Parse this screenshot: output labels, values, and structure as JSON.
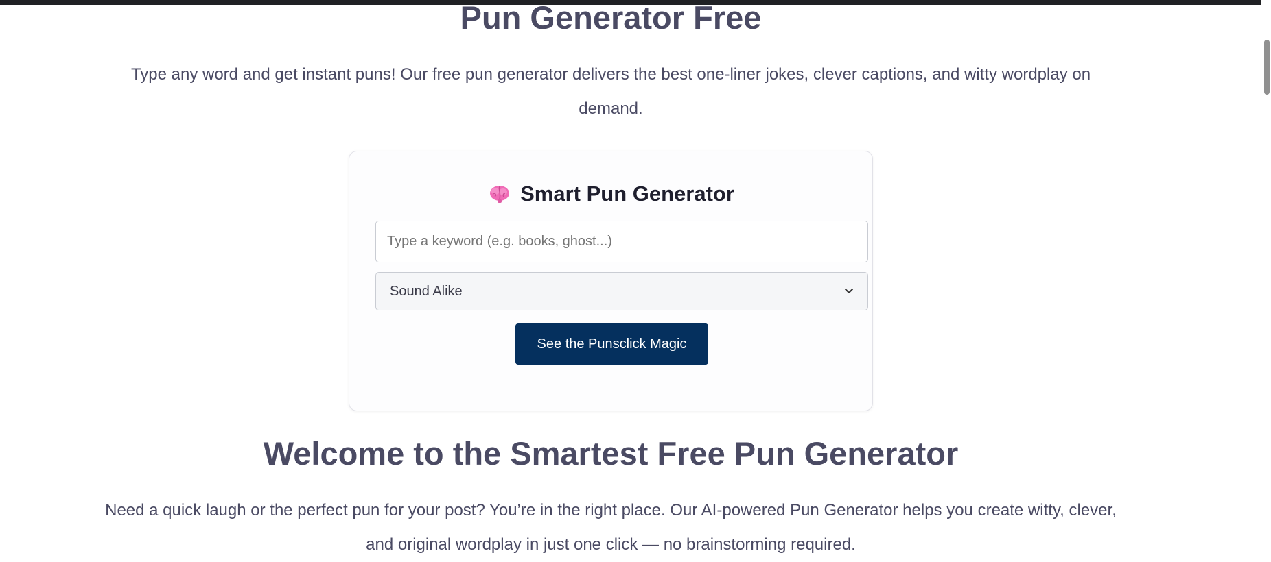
{
  "page": {
    "title": "Pun Generator Free",
    "intro": "Type any word and get instant puns! Our free pun generator delivers the best one-liner jokes, clever captions, and witty wordplay on demand."
  },
  "generator": {
    "title": "Smart Pun Generator",
    "title_icon": "brain-icon",
    "keyword_placeholder": "Type a keyword (e.g. books, ghost...)",
    "keyword_value": "",
    "pun_type_selected": "Sound Alike",
    "submit_label": "See the Punsclick Magic"
  },
  "welcome": {
    "title": "Welcome to the Smartest Free Pun Generator",
    "text": "Need a quick laugh or the perfect pun for your post? You’re in the right place. Our AI-powered Pun Generator helps you create witty, clever, and original wordplay in just one click — no brainstorming required."
  },
  "colors": {
    "heading": "#4a4a63",
    "button_bg": "#05305e",
    "button_text": "#ffffff",
    "icon_pink": "#f06bb6"
  }
}
